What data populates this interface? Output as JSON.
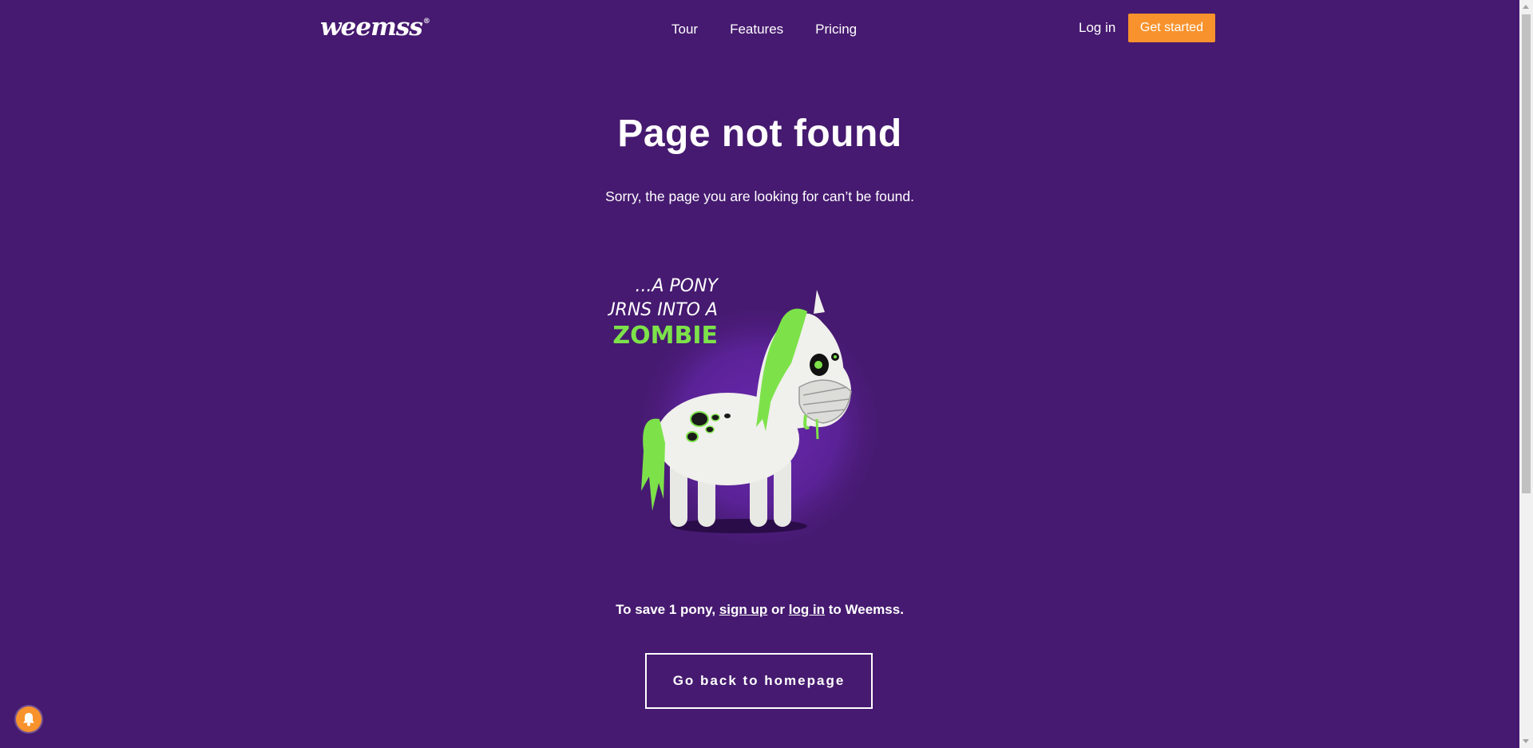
{
  "header": {
    "logo_text": "weemss",
    "logo_mark": "®",
    "nav": [
      {
        "label": "Tour"
      },
      {
        "label": "Features"
      },
      {
        "label": "Pricing"
      }
    ],
    "login_label": "Log in",
    "cta_label": "Get started"
  },
  "main": {
    "title": "Page not found",
    "subtitle": "Sorry, the page you are looking for can’t be found.",
    "illustration": {
      "line1": "...A PONY",
      "line2": "TURNS INTO A",
      "line3": "ZOMBIE"
    },
    "save_prefix": "To save 1 pony, ",
    "signup_link": "sign up",
    "save_middle": " or ",
    "login_link": "log in",
    "save_suffix": " to Weemss.",
    "home_button": "Go back to homepage"
  },
  "icons": {
    "notification": "bell-icon"
  },
  "colors": {
    "background": "#461a70",
    "accent": "#f7922c",
    "zombie_green": "#7de24a"
  }
}
